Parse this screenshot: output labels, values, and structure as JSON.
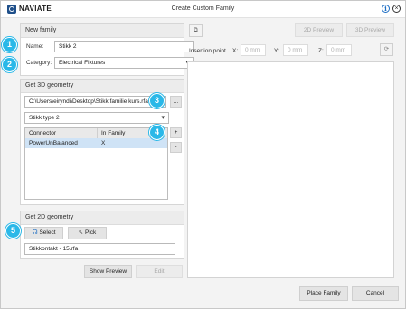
{
  "window": {
    "brand": "NAVIATE",
    "title": "Create Custom Family"
  },
  "new_family": {
    "header": "New family",
    "name_label": "Name:",
    "name_value": "Stikk 2",
    "category_label": "Category:",
    "category_value": "Electrical Fixtures"
  },
  "geometry_3d": {
    "header": "Get 3D geometry",
    "file_path": "C:\\Users\\eiryndi\\Desktop\\Stikk familie kurs.rfa",
    "browse_label": "...",
    "type_value": "Stikk type 2",
    "table": {
      "columns": [
        "Connector",
        "In Family"
      ],
      "rows": [
        {
          "connector": "PowerUnBalanced",
          "in_family": "X"
        }
      ]
    },
    "add_label": "+",
    "remove_label": "-"
  },
  "geometry_2d": {
    "header": "Get 2D geometry",
    "select_label": "Select",
    "pick_label": "Pick",
    "file_value": "Stikkontakt - 15.rfa"
  },
  "actions": {
    "show_preview": "Show Preview",
    "edit": "Edit",
    "place_family": "Place Family",
    "cancel": "Cancel"
  },
  "preview": {
    "preview_2d": "2D Preview",
    "preview_3d": "3D Preview",
    "insertion_label": "Insertion point",
    "x_label": "X:",
    "y_label": "Y:",
    "z_label": "Z:",
    "x_placeholder": "0 mm",
    "y_placeholder": "0 mm",
    "z_placeholder": "0 mm"
  },
  "badges": [
    "1",
    "2",
    "3",
    "4",
    "5"
  ]
}
